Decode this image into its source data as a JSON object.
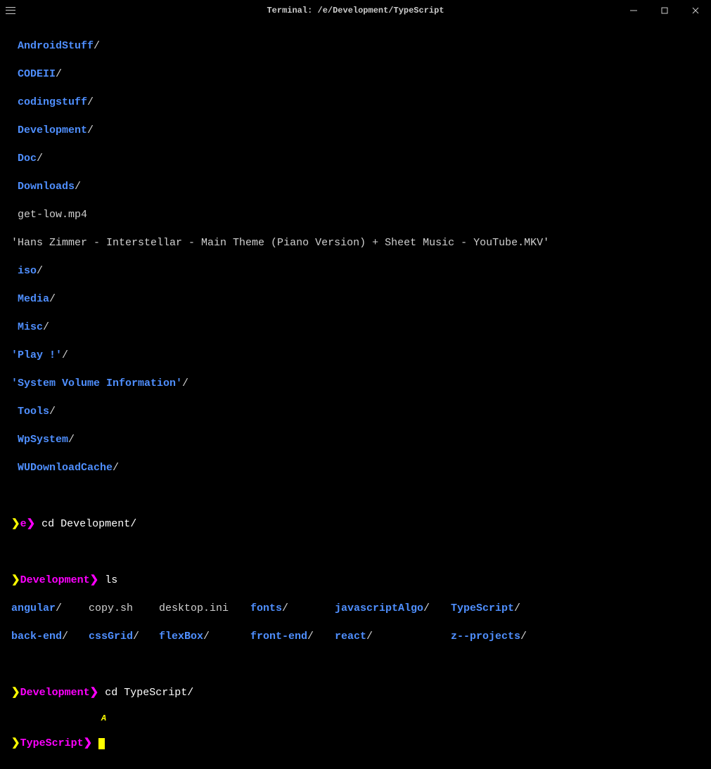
{
  "titlebar": {
    "title": "Terminal: /e/Development/TypeScript"
  },
  "listing1": {
    "items": [
      {
        "name": "AndroidStuff",
        "type": "dir"
      },
      {
        "name": "CODEII",
        "type": "dir"
      },
      {
        "name": "codingstuff",
        "type": "dir"
      },
      {
        "name": "Development",
        "type": "dir"
      },
      {
        "name": "Doc",
        "type": "dir"
      },
      {
        "name": "Downloads",
        "type": "dir"
      },
      {
        "name": "get-low.mp4",
        "type": "file"
      },
      {
        "name": "'Hans Zimmer - Interstellar - Main Theme (Piano Version) + Sheet Music - YouTube.MKV'",
        "type": "quoted"
      },
      {
        "name": "iso",
        "type": "dir"
      },
      {
        "name": "Media",
        "type": "dir"
      },
      {
        "name": "Misc",
        "type": "dir"
      },
      {
        "name": "'Play !'",
        "type": "quoteddir"
      },
      {
        "name": "'System Volume Information'",
        "type": "quoteddir"
      },
      {
        "name": "Tools",
        "type": "dir"
      },
      {
        "name": "WpSystem",
        "type": "dir"
      },
      {
        "name": "WUDownloadCache",
        "type": "dir"
      }
    ]
  },
  "prompts": {
    "p1_sym": "❯",
    "p1_path": "e❯",
    "p1_cmd": "cd Development/",
    "p2_sym": "❯",
    "p2_path": "Development❯",
    "p2_cmd": "ls",
    "p3_sym": "❯",
    "p3_path": "Development❯",
    "p3_cmd": "cd TypeScript/",
    "p4_sym": "❯",
    "p4_path": "TypeScript❯",
    "p4_cmd": ""
  },
  "listing2": {
    "row1": {
      "c1": "angular",
      "c1t": "dir",
      "c2": "copy.sh",
      "c2t": "file",
      "c3": "desktop.ini",
      "c3t": "file",
      "c4": "fonts",
      "c4t": "dir",
      "c5": "javascriptAlgo",
      "c5t": "dir",
      "c6": "TypeScript",
      "c6t": "dir"
    },
    "row2": {
      "c1": "back-end",
      "c1t": "dir",
      "c2": "cssGrid",
      "c2t": "dir",
      "c3": "flexBox",
      "c3t": "dir",
      "c4": "front-end",
      "c4t": "dir",
      "c5": "react",
      "c5t": "dir",
      "c6": "z--projects",
      "c6t": "dir"
    }
  },
  "marker": "A"
}
